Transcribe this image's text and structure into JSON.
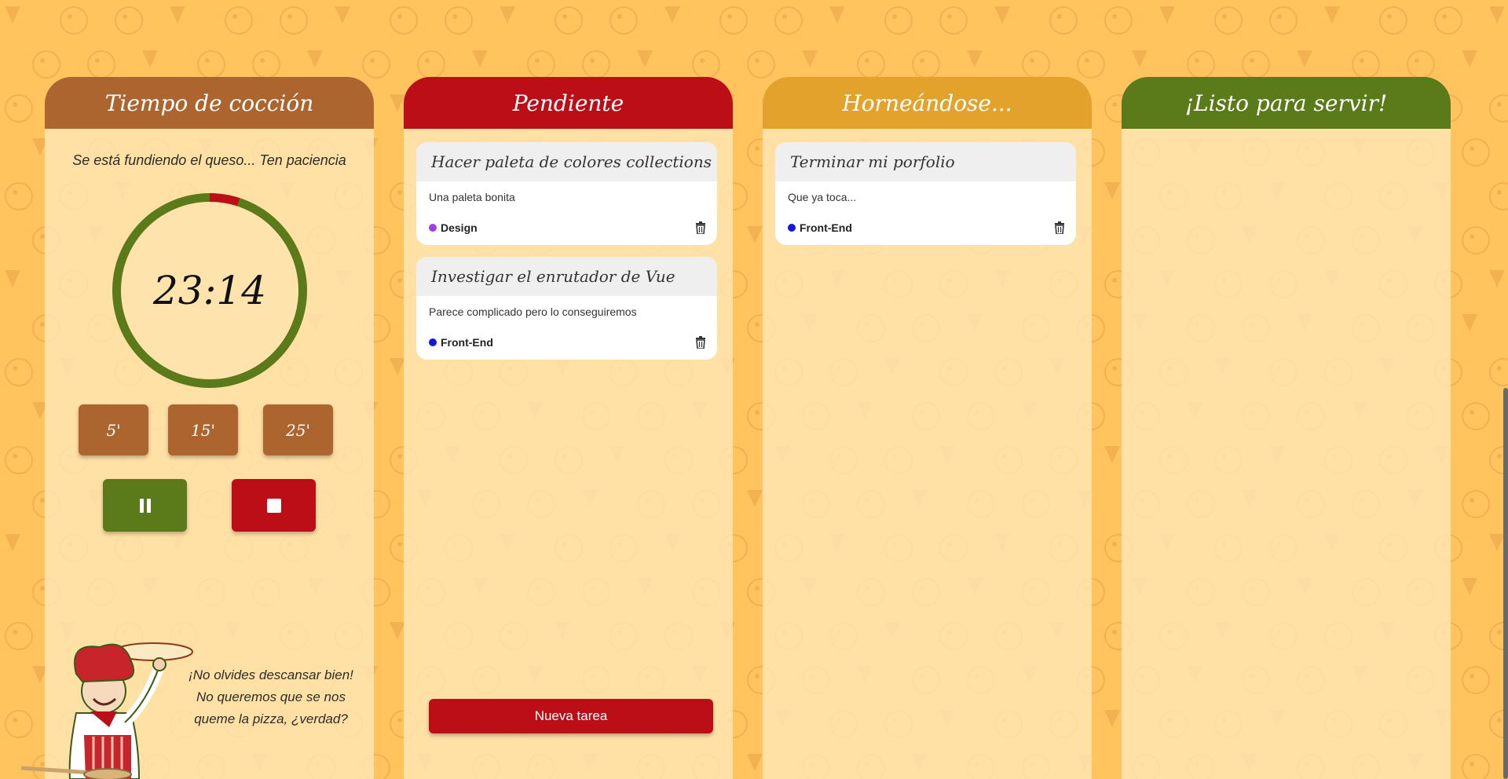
{
  "columns": {
    "timer": {
      "title": "Tiempo de cocción",
      "message": "Se está fundiendo el queso... Ten paciencia",
      "time": "23:14",
      "progress_elapsed_fraction": 0.05,
      "presets": [
        "5'",
        "15'",
        "25'"
      ],
      "pause_icon": "pause-icon",
      "stop_icon": "stop-icon",
      "chef_message": [
        "¡No olvides descansar bien!",
        "No queremos que se nos",
        "queme la pizza, ¿verdad?"
      ]
    },
    "pending": {
      "title": "Pendiente",
      "tasks": [
        {
          "title": "Hacer paleta de colores collections",
          "description": "Una paleta bonita",
          "tag": "Design",
          "tag_color": "#a23be8"
        },
        {
          "title": "Investigar el enrutador de Vue",
          "description": "Parece complicado pero lo conseguiremos",
          "tag": "Front-End",
          "tag_color": "#1416e0"
        }
      ],
      "new_task_label": "Nueva tarea"
    },
    "baking": {
      "title": "Horneándose...",
      "tasks": [
        {
          "title": "Terminar mi porfolio",
          "description": "Que ya toca...",
          "tag": "Front-End",
          "tag_color": "#1416e0"
        }
      ]
    },
    "ready": {
      "title": "¡Listo para servir!",
      "tasks": []
    }
  },
  "colors": {
    "background": "#ffc45e",
    "timer_header": "#ad6530",
    "pending_header": "#bc0e17",
    "baking_header": "#e2a22b",
    "ready_header": "#5b7a19"
  }
}
